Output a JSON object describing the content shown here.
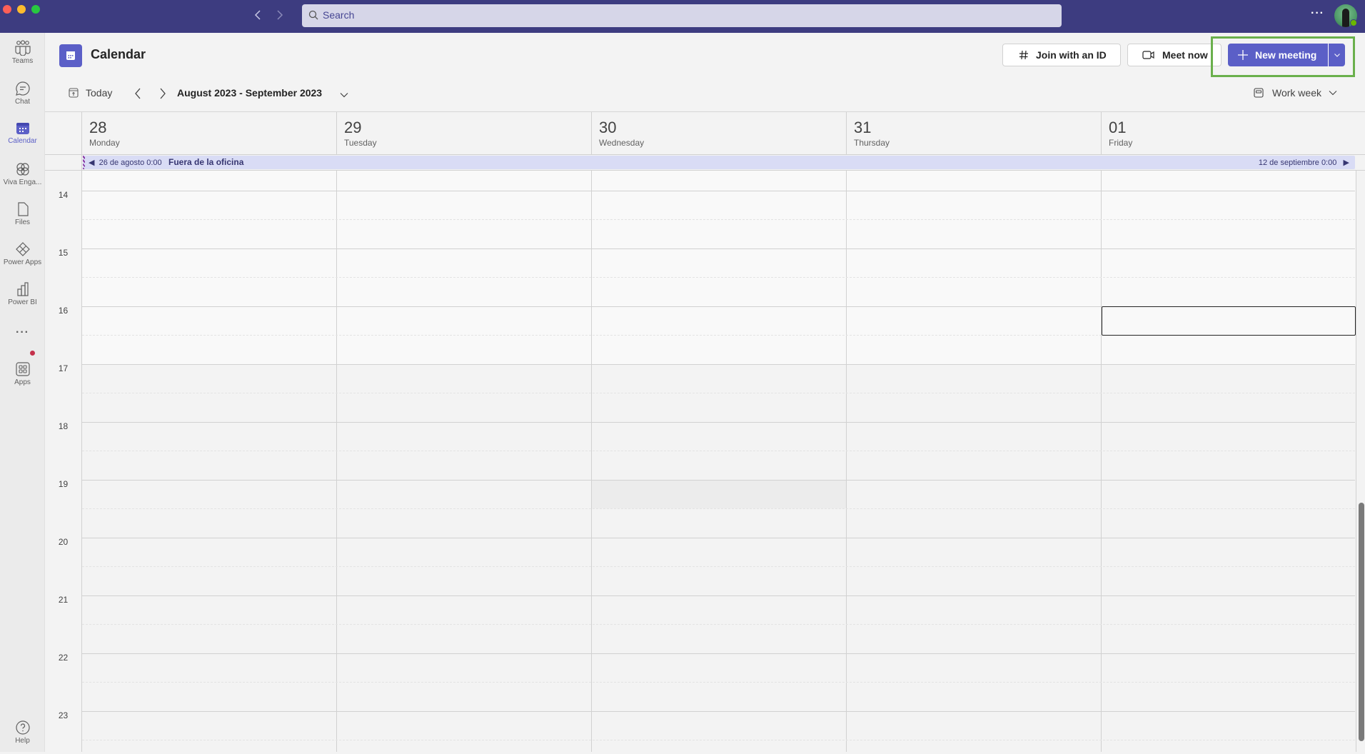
{
  "window": {
    "search_placeholder": "Search",
    "more_label": "···",
    "user_presence": "available"
  },
  "rail": {
    "items": [
      {
        "label": "Teams",
        "icon": "teams-icon"
      },
      {
        "label": "Chat",
        "icon": "chat-icon"
      },
      {
        "label": "Calendar",
        "icon": "calendar-icon",
        "active": true
      },
      {
        "label": "Viva Enga...",
        "icon": "viva-engage-icon"
      },
      {
        "label": "Files",
        "icon": "files-icon"
      },
      {
        "label": "Power Apps",
        "icon": "power-apps-icon"
      },
      {
        "label": "Power BI",
        "icon": "power-bi-icon"
      },
      {
        "label": "···",
        "icon": "more-apps-icon",
        "badge": true
      },
      {
        "label": "Apps",
        "icon": "apps-icon"
      }
    ],
    "help_label": "Help"
  },
  "header": {
    "title": "Calendar",
    "join_label": "Join with an ID",
    "meet_now_label": "Meet now",
    "new_meeting_label": "New meeting",
    "accent": "#5b5fc7",
    "highlight": "#6ab04c"
  },
  "toolbar": {
    "today_label": "Today",
    "date_range": "August 2023 - September 2023",
    "view_label": "Work week"
  },
  "days": [
    {
      "num": "28",
      "name": "Monday"
    },
    {
      "num": "29",
      "name": "Tuesday"
    },
    {
      "num": "30",
      "name": "Wednesday"
    },
    {
      "num": "31",
      "name": "Thursday"
    },
    {
      "num": "01",
      "name": "Friday"
    }
  ],
  "all_day_event": {
    "start": "26 de agosto 0:00",
    "title": "Fuera de la oficina",
    "end": "12 de septiembre 0:00"
  },
  "hours": [
    "14",
    "15",
    "16",
    "17",
    "18",
    "19",
    "20",
    "21",
    "22",
    "23"
  ],
  "work_hours_end": "17",
  "selected_slot": {
    "day": "01",
    "start": "16:00",
    "end": "16:30"
  }
}
